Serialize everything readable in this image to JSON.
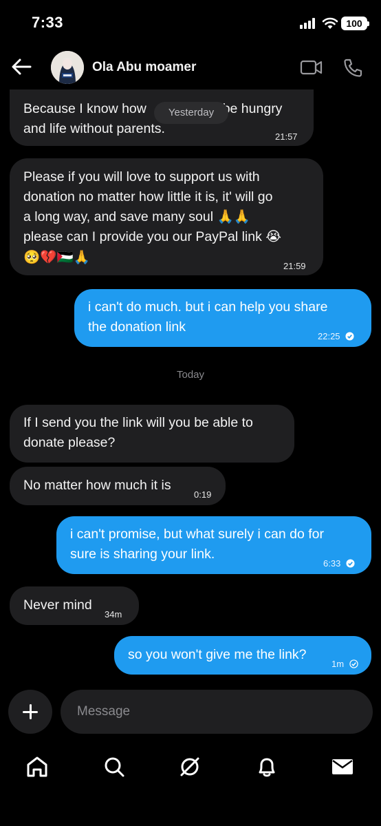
{
  "status": {
    "time": "7:33",
    "battery": "100"
  },
  "header": {
    "name": "Ola Abu moamer"
  },
  "messages": {
    "m1": {
      "line1": "Because I know how",
      "line1b": "be hungry",
      "line2": "and life without parents.",
      "time": "21:57"
    },
    "yesterday_pill": "Yesterday",
    "m2": {
      "l1": "Please if you will love to support us with",
      "l2": "donation no matter how little it is, it' will go",
      "l3": "a long way, and save many soul",
      "l3_emoji": "🙏🙏",
      "l4": "please can I provide you our  PayPal link",
      "l4_emoji": "😭",
      "l5_emoji": "🥺💔🇵🇸🙏",
      "time": "21:59"
    },
    "m3": {
      "l1": "i can't do much. but i can help you share",
      "l2": "the donation link",
      "time": "22:25"
    },
    "today": "Today",
    "m4": {
      "l1": "If I send you the link will you be able to",
      "l2": "donate please?"
    },
    "m5": {
      "text": "No matter how much it is",
      "time": "0:19"
    },
    "m6": {
      "l1": "i can't promise, but what surely i can do for",
      "l2": "sure is sharing your link.",
      "time": "6:33"
    },
    "m7": {
      "text": "Never mind",
      "time": "34m"
    },
    "m8": {
      "text": "so you won't give me the link?",
      "time": "1m"
    }
  },
  "composer": {
    "placeholder": "Message"
  },
  "tabs": [
    "home-icon",
    "search-icon",
    "grok-icon",
    "bell-icon",
    "mail-icon"
  ],
  "colors": {
    "outgoing": "#1f9bf0",
    "incoming": "#1f1f21",
    "background": "#000000"
  }
}
